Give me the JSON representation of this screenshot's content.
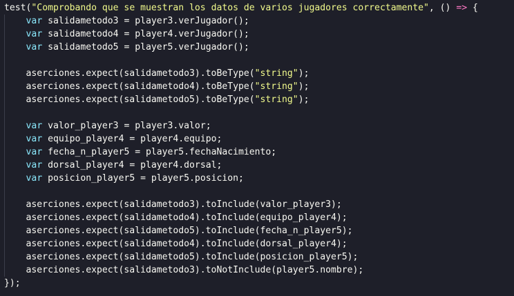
{
  "editor": {
    "lines": [
      [
        {
          "t": "id",
          "v": "test("
        },
        {
          "t": "str",
          "v": "\"Comprobando que se muestran los datos de varios jugadores correctamente\""
        },
        {
          "t": "pun",
          "v": ", () "
        },
        {
          "t": "arrow",
          "v": "=>"
        },
        {
          "t": "pun",
          "v": " {"
        }
      ],
      [
        {
          "t": "pun",
          "v": "    "
        },
        {
          "t": "kw",
          "v": "var"
        },
        {
          "t": "id",
          "v": " salidametodo3 = player3.verJugador();"
        }
      ],
      [
        {
          "t": "pun",
          "v": "    "
        },
        {
          "t": "kw",
          "v": "var"
        },
        {
          "t": "id",
          "v": " salidametodo4 = player4.verJugador();"
        }
      ],
      [
        {
          "t": "pun",
          "v": "    "
        },
        {
          "t": "kw",
          "v": "var"
        },
        {
          "t": "id",
          "v": " salidametodo5 = player5.verJugador();"
        }
      ],
      [],
      [
        {
          "t": "id",
          "v": "    aserciones.expect(salidametodo3).toBeType("
        },
        {
          "t": "str",
          "v": "\"string\""
        },
        {
          "t": "id",
          "v": ");"
        }
      ],
      [
        {
          "t": "id",
          "v": "    aserciones.expect(salidametodo4).toBeType("
        },
        {
          "t": "str",
          "v": "\"string\""
        },
        {
          "t": "id",
          "v": ");"
        }
      ],
      [
        {
          "t": "id",
          "v": "    aserciones.expect(salidametodo5).toBeType("
        },
        {
          "t": "str",
          "v": "\"string\""
        },
        {
          "t": "id",
          "v": ");"
        }
      ],
      [],
      [
        {
          "t": "pun",
          "v": "    "
        },
        {
          "t": "kw",
          "v": "var"
        },
        {
          "t": "id",
          "v": " valor_player3 = player3.valor;"
        }
      ],
      [
        {
          "t": "pun",
          "v": "    "
        },
        {
          "t": "kw",
          "v": "var"
        },
        {
          "t": "id",
          "v": " equipo_player4 = player4.equipo;"
        }
      ],
      [
        {
          "t": "pun",
          "v": "    "
        },
        {
          "t": "kw",
          "v": "var"
        },
        {
          "t": "id",
          "v": " fecha_n_player5 = player5.fechaNacimiento;"
        }
      ],
      [
        {
          "t": "pun",
          "v": "    "
        },
        {
          "t": "kw",
          "v": "var"
        },
        {
          "t": "id",
          "v": " dorsal_player4 = player4.dorsal;"
        }
      ],
      [
        {
          "t": "pun",
          "v": "    "
        },
        {
          "t": "kw",
          "v": "var"
        },
        {
          "t": "id",
          "v": " posicion_player5 = player5.posicion;"
        }
      ],
      [],
      [
        {
          "t": "id",
          "v": "    aserciones.expect(salidametodo3).toInclude(valor_player3);"
        }
      ],
      [
        {
          "t": "id",
          "v": "    aserciones.expect(salidametodo4).toInclude(equipo_player4);"
        }
      ],
      [
        {
          "t": "id",
          "v": "    aserciones.expect(salidametodo5).toInclude(fecha_n_player5);"
        }
      ],
      [
        {
          "t": "id",
          "v": "    aserciones.expect(salidametodo4).toInclude(dorsal_player4);"
        }
      ],
      [
        {
          "t": "id",
          "v": "    aserciones.expect(salidametodo5).toInclude(posicion_player5);"
        }
      ],
      [
        {
          "t": "id",
          "v": "    aserciones.expect(salidametodo3).toNotInclude(player5.nombre);"
        }
      ],
      [
        {
          "t": "id",
          "v": "});"
        }
      ]
    ]
  },
  "colors": {
    "background": "#1e1f29",
    "keyword": "#8be9fd",
    "string": "#f1fa8c",
    "arrow": "#ff79c6",
    "text": "#f8f8f2"
  }
}
